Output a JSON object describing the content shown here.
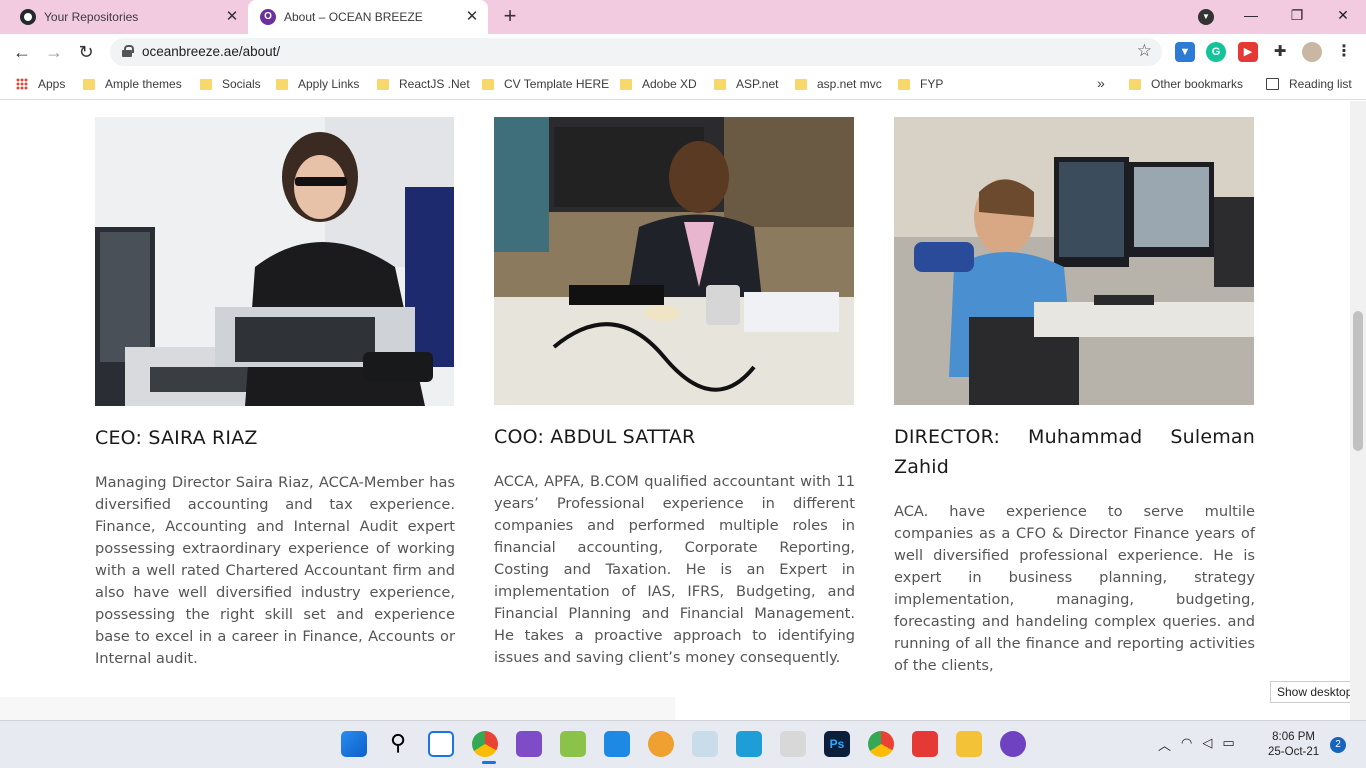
{
  "browser": {
    "tabs": [
      {
        "title": "Your Repositories"
      },
      {
        "title": "About – OCEAN BREEZE"
      }
    ],
    "url": "oceanbreeze.ae/about/",
    "bookmarks": [
      "Apps",
      "Ample themes",
      "Socials",
      "Apply Links",
      "ReactJS .Net",
      "CV Template HERE",
      "Adobe XD",
      "ASP.net",
      "asp.net mvc",
      "FYP"
    ],
    "overflow": "»",
    "other_bookmarks": "Other bookmarks",
    "reading_list": "Reading list"
  },
  "team": [
    {
      "title": "CEO: SAIRA RIAZ",
      "bio": "Managing Director Saira Riaz, ACCA-Member has diversified accounting and tax experience. Finance, Accounting and Internal Audit expert possessing extraordinary experience of working with a well rated Chartered Accountant firm and also have well diversified industry experience, possessing the right skill set and experience base to excel in a career in Finance, Accounts or Internal audit."
    },
    {
      "title": "COO: ABDUL SATTAR",
      "bio": "ACCA, APFA, B.COM qualified accountant with 11 years’ Professional experience in different companies and performed multiple roles in financial accounting, Corporate Reporting, Costing and Taxation. He is an Expert in implementation of IAS, IFRS, Budgeting, and Financial Planning and Financial Management. He takes a proactive approach to identifying issues and saving client’s money consequently."
    },
    {
      "title": "DIRECTOR: Muhammad Suleman Zahid",
      "bio": "ACA. have experience to serve multile companies as a CFO & Director Finance years of well diversified professional experience. He is expert in business planning, strategy implementation, managing, budgeting, forecasting and handeling complex queries. and running of all the finance and reporting activities of the clients,"
    }
  ],
  "tooltip": "Show desktop",
  "taskbar": {
    "time": "8:06 PM",
    "date": "25-Oct-21",
    "notifications": "2"
  }
}
